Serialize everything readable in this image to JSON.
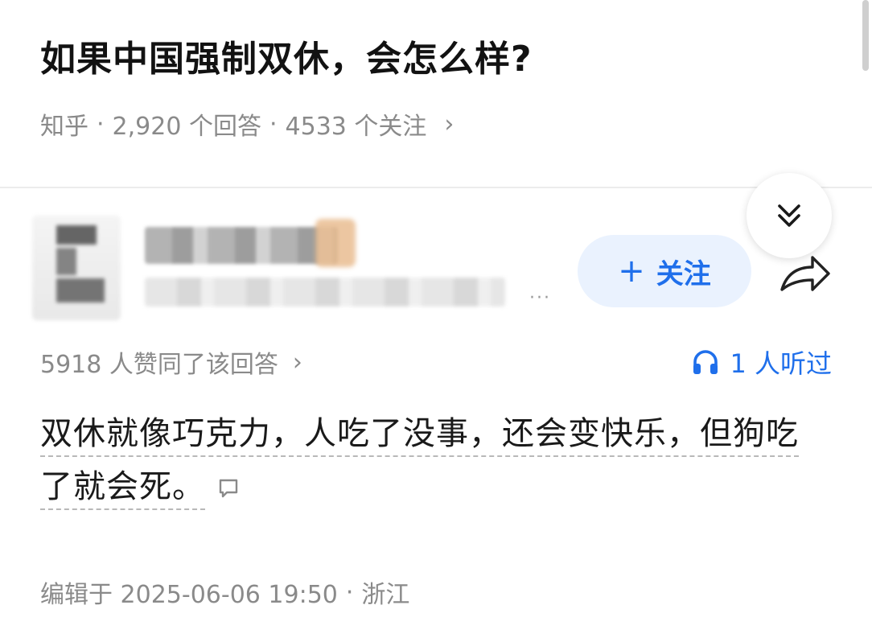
{
  "question": {
    "title": "如果中国强制双休，会怎么样?",
    "source": "知乎",
    "answers_count": "2,920 个回答",
    "followers_count": "4533 个关注",
    "separator": "·",
    "chevron": "›"
  },
  "author": {
    "follow_label": "关注",
    "follow_icon": "plus-icon",
    "more_dots": "···"
  },
  "answer": {
    "votes_text": "5918 人赞同了该回答",
    "votes_chevron": "›",
    "listeners_text": "1 人听过",
    "content": "双休就像巧克力，人吃了没事，还会变快乐，但狗吃了就会死。",
    "edited_prefix": "编辑于 2025-06-06 19:50",
    "location": "浙江",
    "separator": "·"
  },
  "colors": {
    "accent": "#1f6feb",
    "follow_bg": "#eaf2fe",
    "meta_text": "#8a8a8a"
  }
}
